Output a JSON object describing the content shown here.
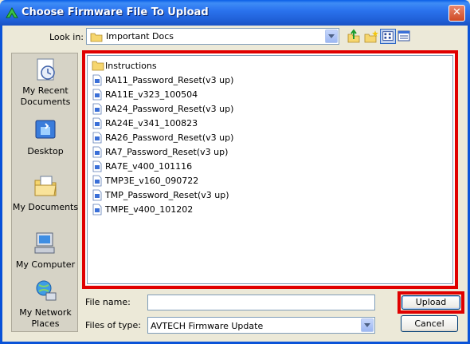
{
  "window": {
    "title": "Choose Firmware File To Upload",
    "close_label": "✕"
  },
  "toolbar": {
    "lookin_label": "Look in:",
    "lookin_value": "Important Docs",
    "icons": [
      "up-folder-icon",
      "new-folder-icon",
      "list-view-icon",
      "details-view-icon"
    ]
  },
  "places": [
    {
      "label": "My Recent Documents",
      "icon": "recent-documents-icon"
    },
    {
      "label": "Desktop",
      "icon": "desktop-icon"
    },
    {
      "label": "My Documents",
      "icon": "my-documents-icon"
    },
    {
      "label": "My Computer",
      "icon": "my-computer-icon"
    },
    {
      "label": "My Network Places",
      "icon": "network-places-icon"
    }
  ],
  "files": [
    {
      "name": "Instructions",
      "type": "folder"
    },
    {
      "name": "RA11_Password_Reset(v3 up)",
      "type": "file"
    },
    {
      "name": "RA11E_v323_100504",
      "type": "file"
    },
    {
      "name": "RA24_Password_Reset(v3 up)",
      "type": "file"
    },
    {
      "name": "RA24E_v341_100823",
      "type": "file"
    },
    {
      "name": "RA26_Password_Reset(v3 up)",
      "type": "file"
    },
    {
      "name": "RA7_Password_Reset(v3 up)",
      "type": "file"
    },
    {
      "name": "RA7E_v400_101116",
      "type": "file"
    },
    {
      "name": "TMP3E_v160_090722",
      "type": "file"
    },
    {
      "name": "TMP_Password_Reset(v3 up)",
      "type": "file"
    },
    {
      "name": "TMPE_v400_101202",
      "type": "file"
    }
  ],
  "form": {
    "filename_label": "File name:",
    "filename_value": "",
    "filetype_label": "Files of type:",
    "filetype_value": "AVTECH Firmware Update",
    "upload_label": "Upload",
    "cancel_label": "Cancel"
  },
  "colors": {
    "titlebar": "#0A5FE6",
    "highlight": "#E00000",
    "dialog_bg": "#ECE9D8"
  }
}
